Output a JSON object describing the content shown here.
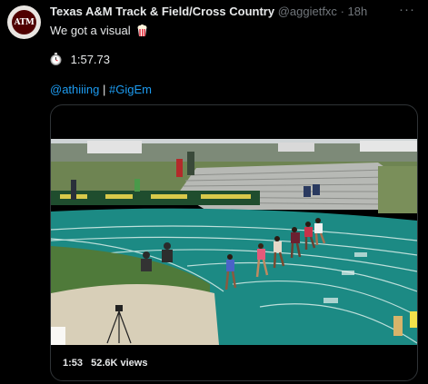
{
  "tweet": {
    "author_name": "Texas A&M Track & Field/Cross Country",
    "author_handle": "@aggietfxc",
    "separator": "·",
    "time": "18h",
    "more_label": "···",
    "text_line1": "We got a visual",
    "time_result": "1:57.73",
    "mention": "@athiiing",
    "divider": "|",
    "hashtag": "#GigEm",
    "avatar_text": "ATM"
  },
  "video": {
    "duration": "1:53",
    "views": "52.6K views"
  },
  "colors": {
    "background": "#000000",
    "text": "#e7e9ea",
    "muted": "#71767b",
    "link": "#1d9bf0",
    "track": "#1c8a84",
    "aggie_maroon": "#500000"
  },
  "icons": {
    "popcorn": "popcorn-icon",
    "stopwatch": "stopwatch-icon",
    "more": "more-icon"
  }
}
